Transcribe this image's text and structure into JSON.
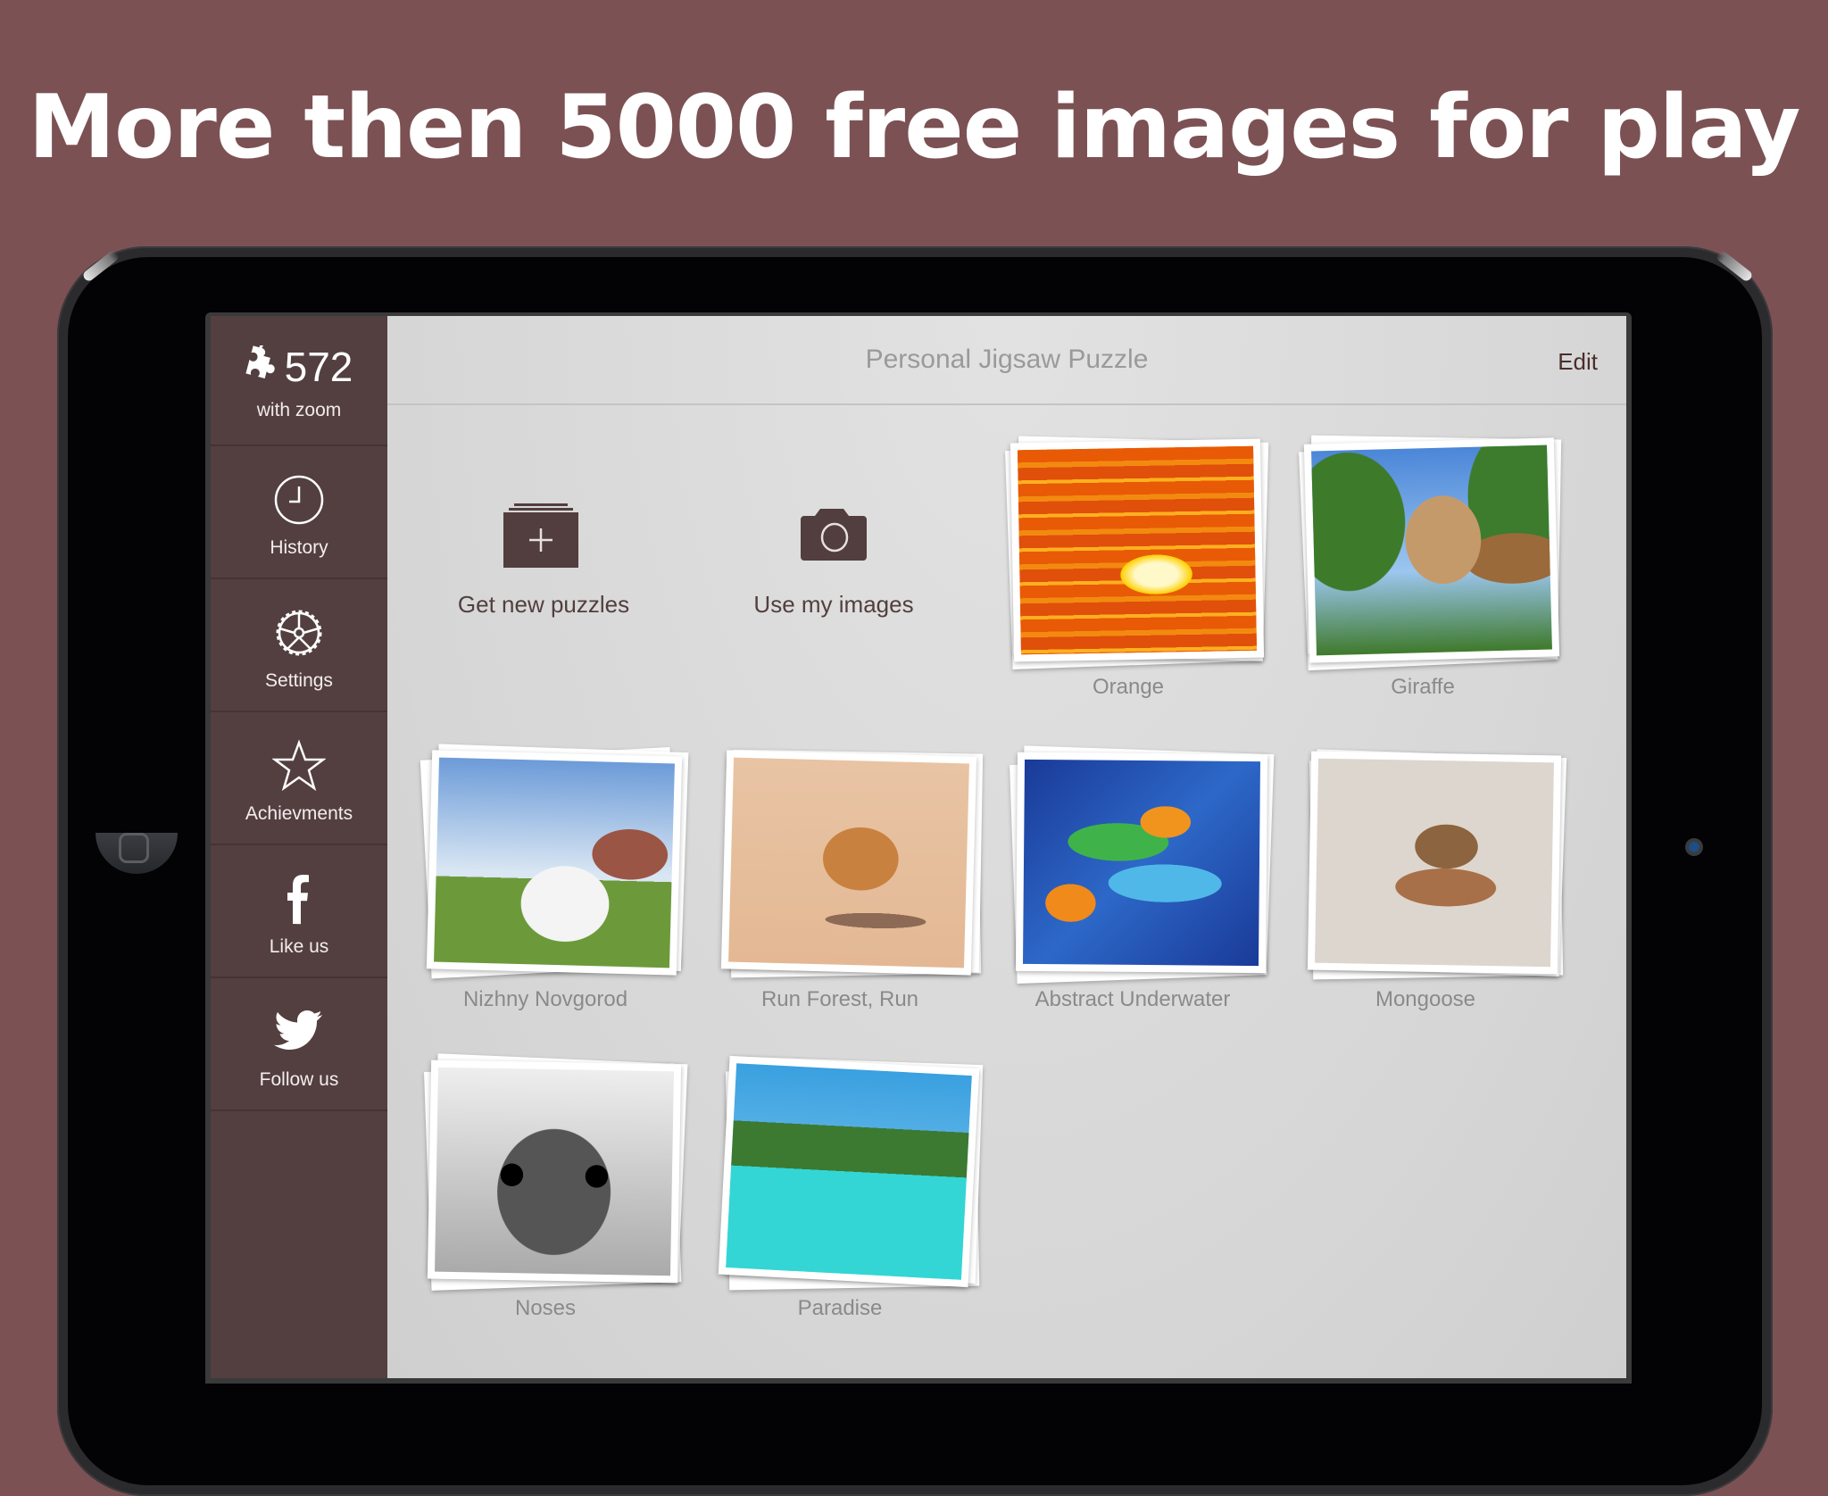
{
  "headline": "More then 5000 free images for play",
  "sidebar": {
    "count": "572",
    "count_sub": "with zoom",
    "items": [
      {
        "label": "History",
        "icon": "clock-icon"
      },
      {
        "label": "Settings",
        "icon": "gear-icon"
      },
      {
        "label": "Achievments",
        "icon": "star-icon"
      },
      {
        "label": "Like us",
        "icon": "facebook-icon"
      },
      {
        "label": "Follow us",
        "icon": "twitter-icon"
      }
    ]
  },
  "header": {
    "title": "Personal Jigsaw Puzzle",
    "edit_label": "Edit"
  },
  "actions": {
    "get_new": "Get new puzzles",
    "use_mine": "Use my images"
  },
  "puzzles": [
    {
      "label": "Orange"
    },
    {
      "label": "Giraffe"
    },
    {
      "label": "Nizhny Novgorod"
    },
    {
      "label": "Run Forest, Run"
    },
    {
      "label": "Abstract Underwater"
    },
    {
      "label": "Mongoose"
    },
    {
      "label": "Noses"
    },
    {
      "label": "Paradise"
    }
  ],
  "colors": {
    "background": "#7c5153",
    "sidebar": "#533f40",
    "accent_text": "#4a2e2e"
  }
}
